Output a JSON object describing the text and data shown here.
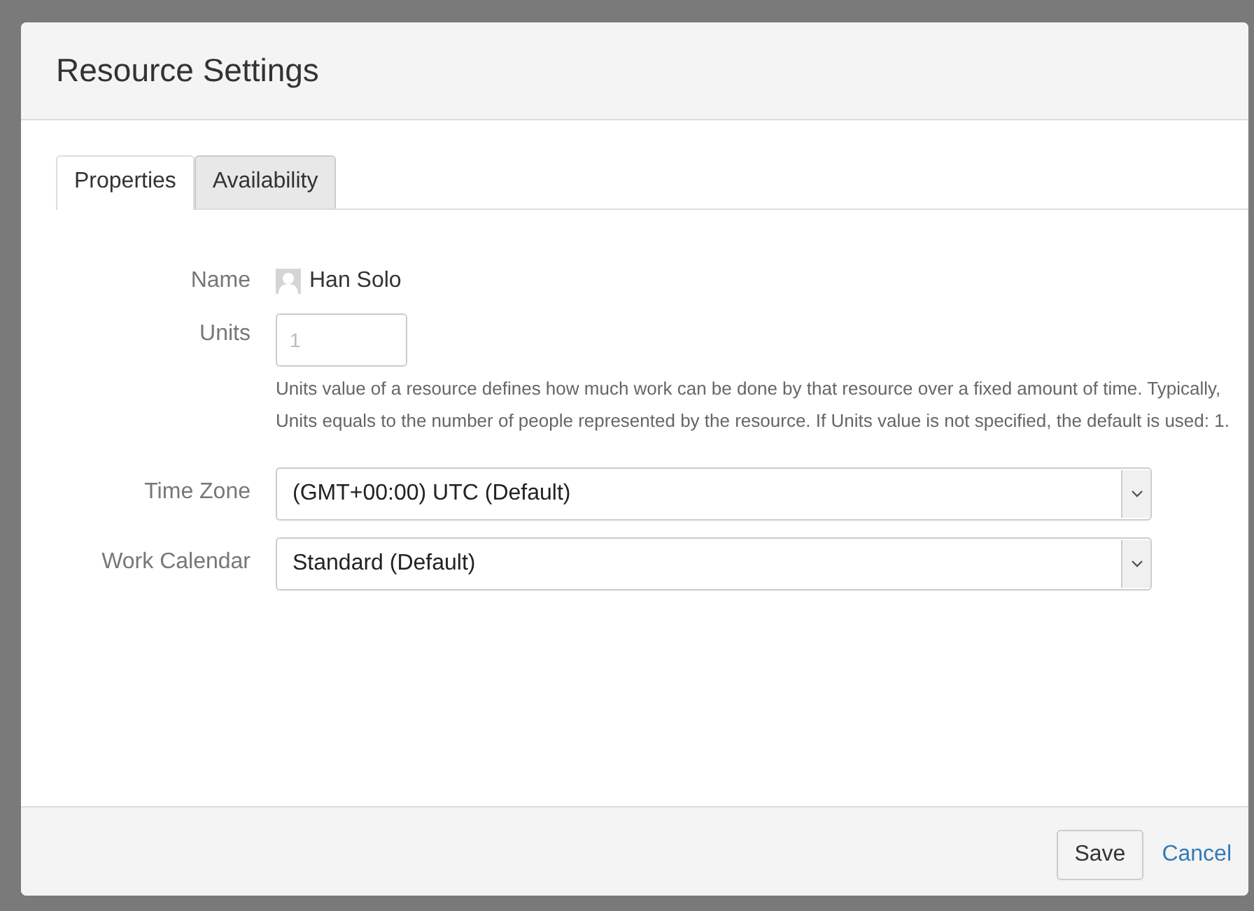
{
  "dialog": {
    "title": "Resource Settings",
    "tabs": [
      {
        "label": "Properties",
        "selected": true
      },
      {
        "label": "Availability",
        "selected": false
      }
    ],
    "name": {
      "label": "Name",
      "value": "Han Solo"
    },
    "units": {
      "label": "Units",
      "placeholder": "1",
      "help": "Units value of a resource defines how much work can be done by that resource over a fixed amount of time. Typically, Units equals to the number of people represented by the resource. If Units value is not specified, the default is used: 1."
    },
    "selects": [
      {
        "label": "Time Zone",
        "value": "(GMT+00:00) UTC (Default)"
      },
      {
        "label": "Work Calendar",
        "value": "Standard (Default)"
      }
    ],
    "buttons": {
      "save": "Save",
      "cancel": "Cancel"
    }
  }
}
